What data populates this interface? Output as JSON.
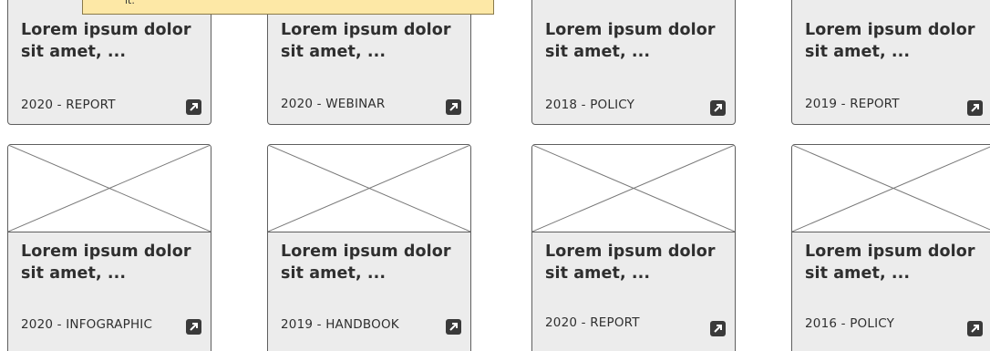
{
  "tooltip": {
    "text": "it."
  },
  "cards": [
    {
      "title_line1": "Lorem ipsum dolor",
      "title_line2": "sit amet, ...",
      "meta": "2020 - REPORT"
    },
    {
      "title_line1": "Lorem ipsum dolor",
      "title_line2": "sit amet, ...",
      "meta": "2020 - WEBINAR"
    },
    {
      "title_line1": "Lorem ipsum dolor",
      "title_line2": "sit amet, ...",
      "meta": "2018 - POLICY"
    },
    {
      "title_line1": "Lorem ipsum dolor",
      "title_line2": "sit amet, ...",
      "meta": "2019 - REPORT"
    },
    {
      "title_line1": "Lorem ipsum dolor",
      "title_line2": "sit amet, ...",
      "meta": "2020 - INFOGRAPHIC"
    },
    {
      "title_line1": "Lorem ipsum dolor",
      "title_line2": "sit amet, ...",
      "meta": "2019 - HANDBOOK"
    },
    {
      "title_line1": "Lorem ipsum dolor",
      "title_line2": "sit amet, ...",
      "meta": "2020 - REPORT"
    },
    {
      "title_line1": "Lorem ipsum dolor",
      "title_line2": "sit amet, ...",
      "meta": "2016 - POLICY"
    }
  ],
  "icons": {
    "card_link": "external-link-icon",
    "thumbnail": "image-placeholder-icon"
  }
}
